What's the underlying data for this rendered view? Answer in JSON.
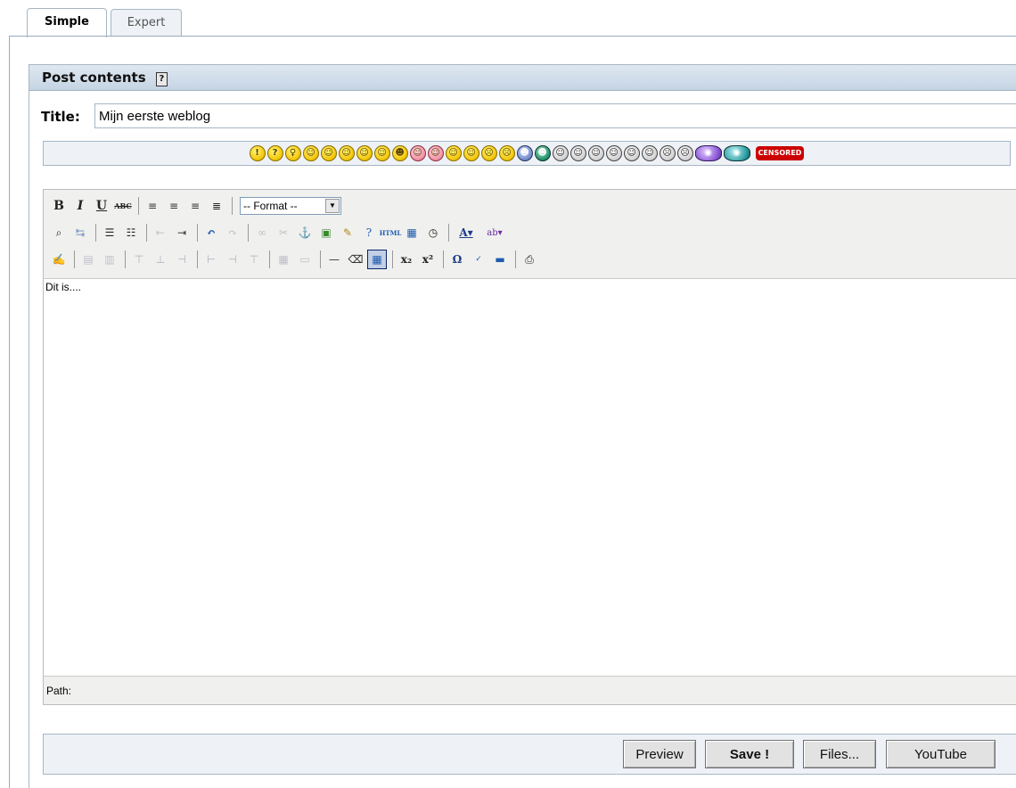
{
  "tabs": [
    {
      "label": "Simple",
      "active": true
    },
    {
      "label": "Expert",
      "active": false
    }
  ],
  "panel": {
    "title": "Post contents",
    "help_icon": "?"
  },
  "title_field": {
    "label": "Title:",
    "value": "Mijn eerste weblog"
  },
  "smileys": [
    {
      "name": "exclaim",
      "glyph": "!"
    },
    {
      "name": "question",
      "glyph": "?"
    },
    {
      "name": "idea",
      "glyph": "♀"
    },
    {
      "name": "smile",
      "glyph": "☺"
    },
    {
      "name": "grin",
      "glyph": "☺"
    },
    {
      "name": "laugh",
      "glyph": "☺"
    },
    {
      "name": "cool",
      "glyph": "☺"
    },
    {
      "name": "wink",
      "glyph": "☺"
    },
    {
      "name": "evil",
      "glyph": "☻"
    },
    {
      "name": "rolleyes",
      "glyph": "☺"
    },
    {
      "name": "blush",
      "glyph": "☺"
    },
    {
      "name": "neutral",
      "glyph": "☺"
    },
    {
      "name": "confused",
      "glyph": "☺"
    },
    {
      "name": "sad",
      "glyph": "☹"
    },
    {
      "name": "cry",
      "glyph": "☹"
    },
    {
      "name": "sick",
      "glyph": "☻"
    },
    {
      "name": "mad",
      "glyph": "☻"
    },
    {
      "name": "gray-smile",
      "glyph": "☺"
    },
    {
      "name": "gray-smile2",
      "glyph": "☺"
    },
    {
      "name": "gray-grin",
      "glyph": "☺"
    },
    {
      "name": "gray-grin2",
      "glyph": "☺"
    },
    {
      "name": "gray-shock",
      "glyph": "☺"
    },
    {
      "name": "gray-eek",
      "glyph": "☺"
    },
    {
      "name": "gray-sad",
      "glyph": "☹"
    },
    {
      "name": "gray-cry",
      "glyph": "☹"
    },
    {
      "name": "alien",
      "glyph": "◉"
    },
    {
      "name": "fish",
      "glyph": "◉"
    }
  ],
  "censored_label": "CENSORED",
  "editor": {
    "format_select": "-- Format --",
    "content": "Dit is....",
    "path_label": "Path:"
  },
  "actions": {
    "preview": "Preview",
    "save": "Save !",
    "files": "Files...",
    "youtube": "YouTube"
  }
}
